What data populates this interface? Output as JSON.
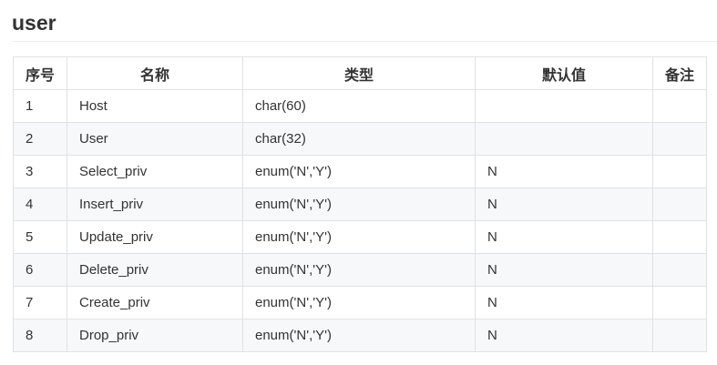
{
  "section": {
    "title": "user"
  },
  "table": {
    "headers": [
      "序号",
      "名称",
      "类型",
      "默认值",
      "备注"
    ],
    "rows": [
      {
        "index": "1",
        "name": "Host",
        "type": "char(60)",
        "default": "",
        "note": ""
      },
      {
        "index": "2",
        "name": "User",
        "type": "char(32)",
        "default": "",
        "note": ""
      },
      {
        "index": "3",
        "name": "Select_priv",
        "type": "enum('N','Y')",
        "default": "N",
        "note": ""
      },
      {
        "index": "4",
        "name": "Insert_priv",
        "type": "enum('N','Y')",
        "default": "N",
        "note": ""
      },
      {
        "index": "5",
        "name": "Update_priv",
        "type": "enum('N','Y')",
        "default": "N",
        "note": ""
      },
      {
        "index": "6",
        "name": "Delete_priv",
        "type": "enum('N','Y')",
        "default": "N",
        "note": ""
      },
      {
        "index": "7",
        "name": "Create_priv",
        "type": "enum('N','Y')",
        "default": "N",
        "note": ""
      },
      {
        "index": "8",
        "name": "Drop_priv",
        "type": "enum('N','Y')",
        "default": "N",
        "note": ""
      }
    ]
  }
}
